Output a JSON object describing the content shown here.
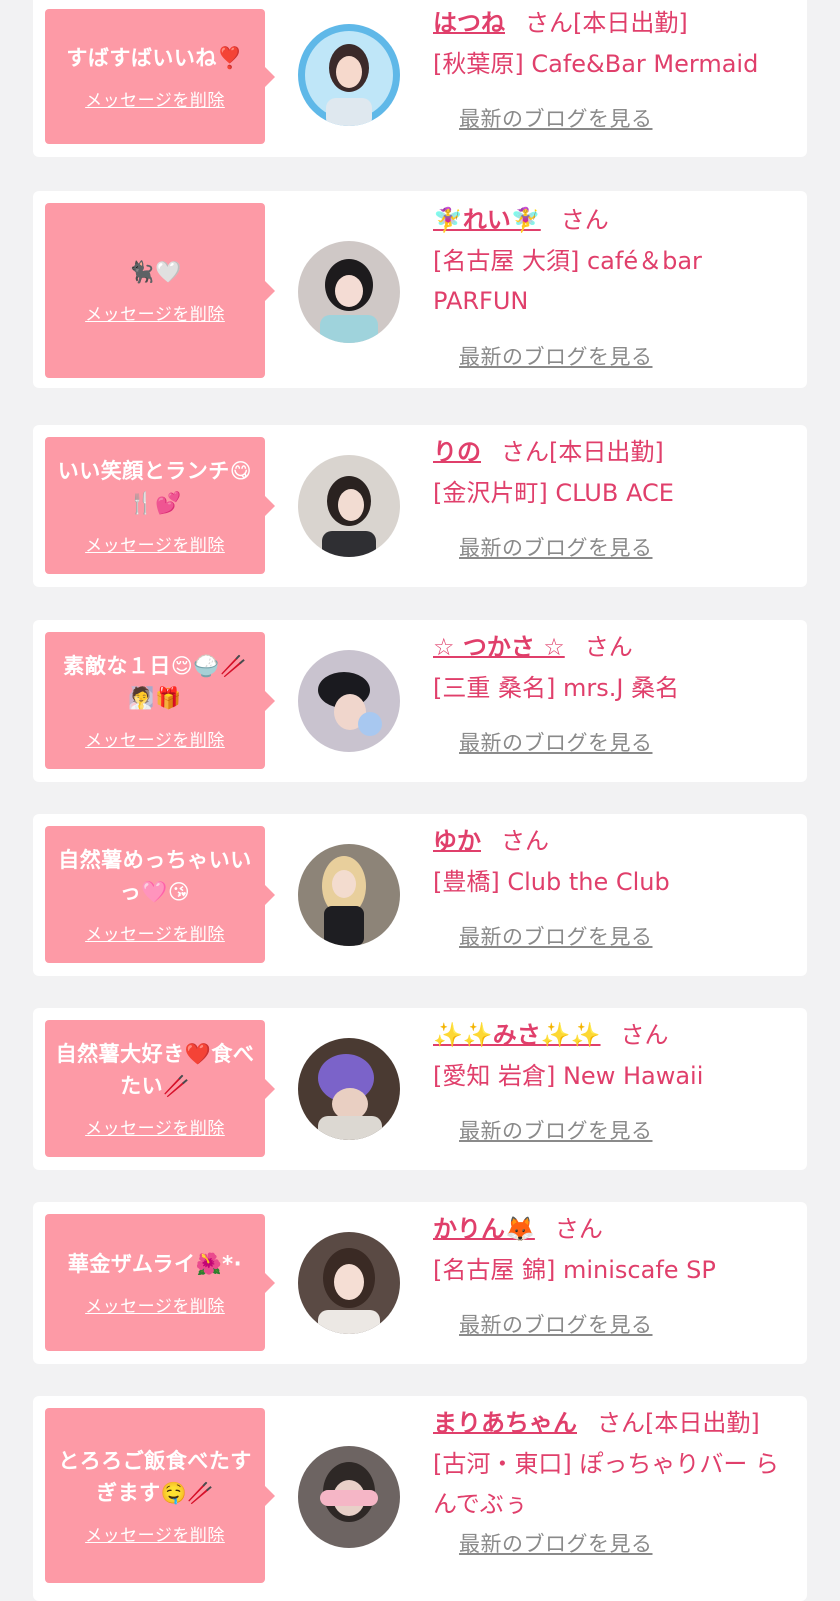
{
  "messages": [
    {
      "message": "すばすばいいね❣️",
      "delete_label": "メッセージを削除",
      "name": "はつね",
      "san": "さん[本日出勤]",
      "shop": "[秋葉原] Cafe&Bar Mermaid",
      "blog_label": "最新のブログを見る"
    },
    {
      "message": "🐈‍⬛🤍",
      "delete_label": "メッセージを削除",
      "name": "🧚‍♀️れい🧚‍♀️",
      "san": "さん",
      "shop": "[名古屋 大須] café＆bar PARFUN",
      "blog_label": "最新のブログを見る"
    },
    {
      "message": "いい笑顔とランチ😋🍴💕",
      "delete_label": "メッセージを削除",
      "name": "りの",
      "san": "さん[本日出勤]",
      "shop": "[金沢片町] CLUB ACE",
      "blog_label": "最新のブログを見る"
    },
    {
      "message": "素敵な１日😌🍚🥢🧖🎁",
      "delete_label": "メッセージを削除",
      "name": "☆ つかさ ☆",
      "san": "さん",
      "shop": "[三重 桑名] mrs.J 桑名",
      "blog_label": "最新のブログを見る"
    },
    {
      "message": "自然薯めっちゃいいっ🩷😘",
      "delete_label": "メッセージを削除",
      "name": "ゆか",
      "san": "さん",
      "shop": "[豊橋] Club the Club",
      "blog_label": "最新のブログを見る"
    },
    {
      "message": "自然薯大好き❤️食べたい🥢",
      "delete_label": "メッセージを削除",
      "name": "✨✨みさ✨✨",
      "san": "さん",
      "shop": "[愛知 岩倉] New Hawaii",
      "blog_label": "最新のブログを見る"
    },
    {
      "message": "華金ザムライ🌺*·",
      "delete_label": "メッセージを削除",
      "name": "かりん🦊",
      "san": "さん",
      "shop": "[名古屋 錦] miniscafe SP",
      "blog_label": "最新のブログを見る"
    },
    {
      "message": "とろろご飯食べたすぎます🤤🥢",
      "delete_label": "メッセージを削除",
      "name": "まりあちゃん",
      "san": "さん[本日出勤]",
      "shop": "[古河・東口] ぽっちゃりバー らんでぶぅ",
      "blog_label": "最新のブログを見る"
    }
  ],
  "colors": {
    "page_bg": "#f2f2f3",
    "card_bg": "#ffffff",
    "bubble_bg": "#fd9aa6",
    "accent": "#e03f6b",
    "link_gray": "#8a8a8a"
  },
  "icons": [
    "avatar-photo"
  ]
}
